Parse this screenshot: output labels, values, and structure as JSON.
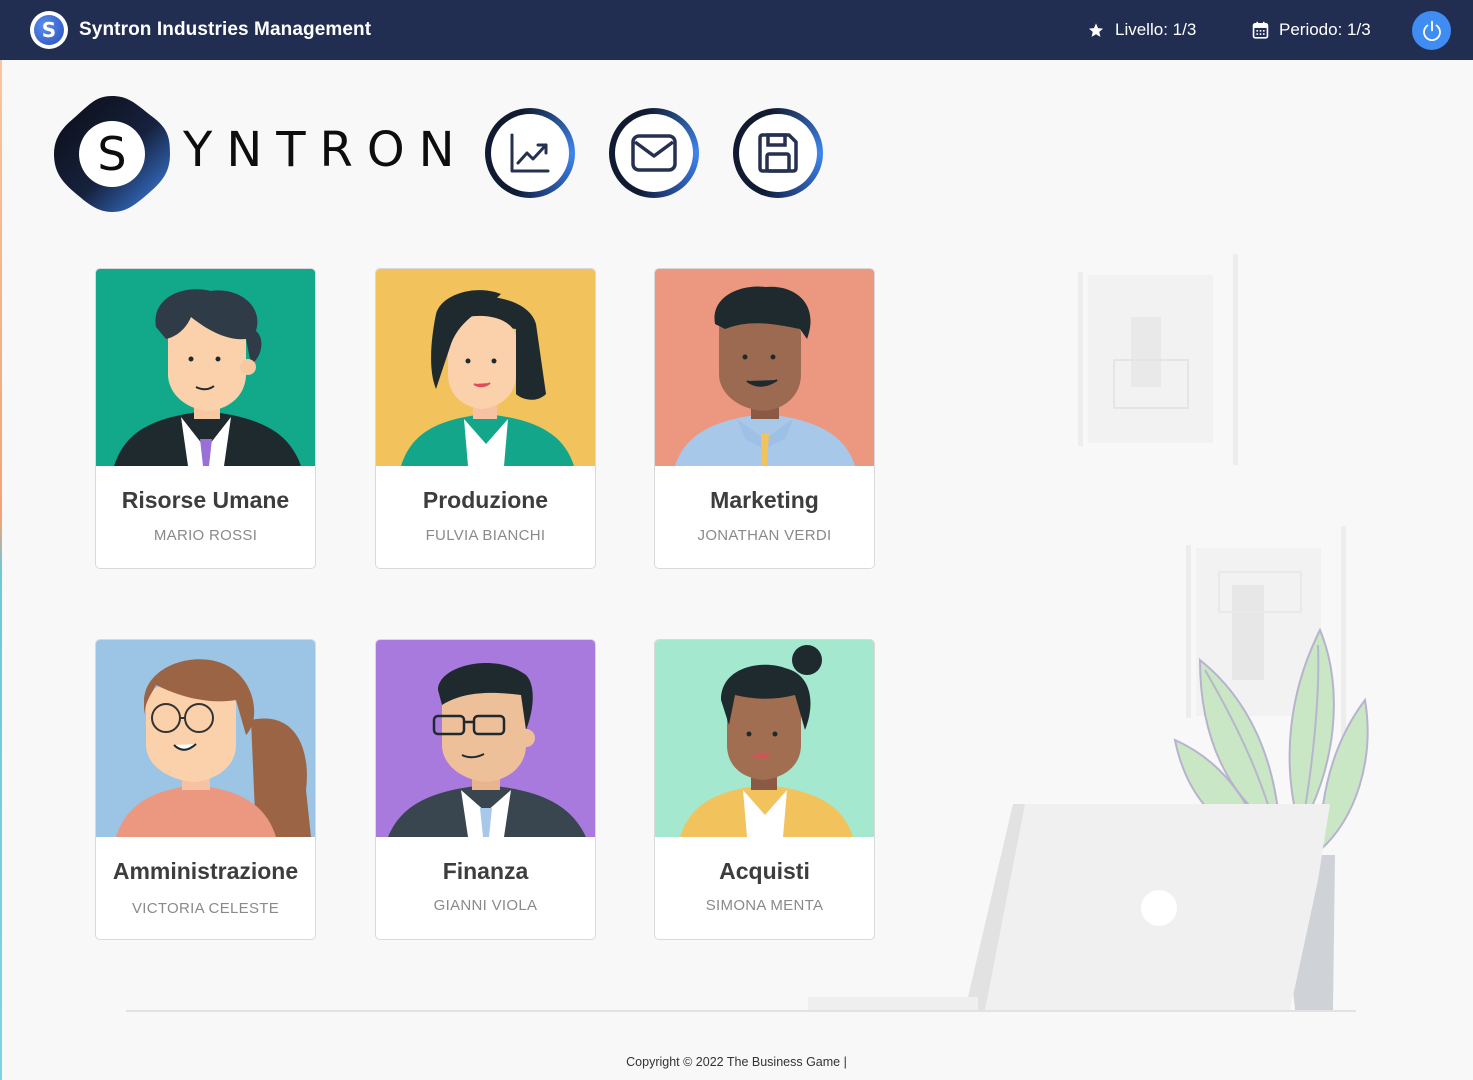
{
  "topbar": {
    "logo_letter": "S",
    "title": "Syntron Industries Management",
    "level": "Livello: 1/3",
    "period": "Periodo: 1/3",
    "icons": {
      "level": "star-icon",
      "period": "calendar-icon",
      "power": "power-icon"
    }
  },
  "logo": {
    "letter": "S",
    "wordmark": "YNTRON"
  },
  "actions": [
    {
      "icon": "chart-icon"
    },
    {
      "icon": "mail-icon"
    },
    {
      "icon": "save-icon"
    }
  ],
  "departments": [
    {
      "dept": "Risorse Umane",
      "person": "MARIO ROSSI",
      "bg": "#12a98b"
    },
    {
      "dept": "Produzione",
      "person": "FULVIA BIANCHI",
      "bg": "#f2c35c"
    },
    {
      "dept": "Marketing",
      "person": "JONATHAN VERDI",
      "bg": "#ec9880"
    },
    {
      "dept": "Amministrazione",
      "person": "VICTORIA CELESTE",
      "bg": "#9cc4e4"
    },
    {
      "dept": "Finanza",
      "person": "GIANNI VIOLA",
      "bg": "#a97ade"
    },
    {
      "dept": "Acquisti",
      "person": "SIMONA MENTA",
      "bg": "#a3e8cf"
    }
  ],
  "footer": {
    "copyright": "Copyright © 2022 The Business Game |"
  },
  "colors": {
    "topbar": "#222d52",
    "accent": "#3f8cf3"
  }
}
